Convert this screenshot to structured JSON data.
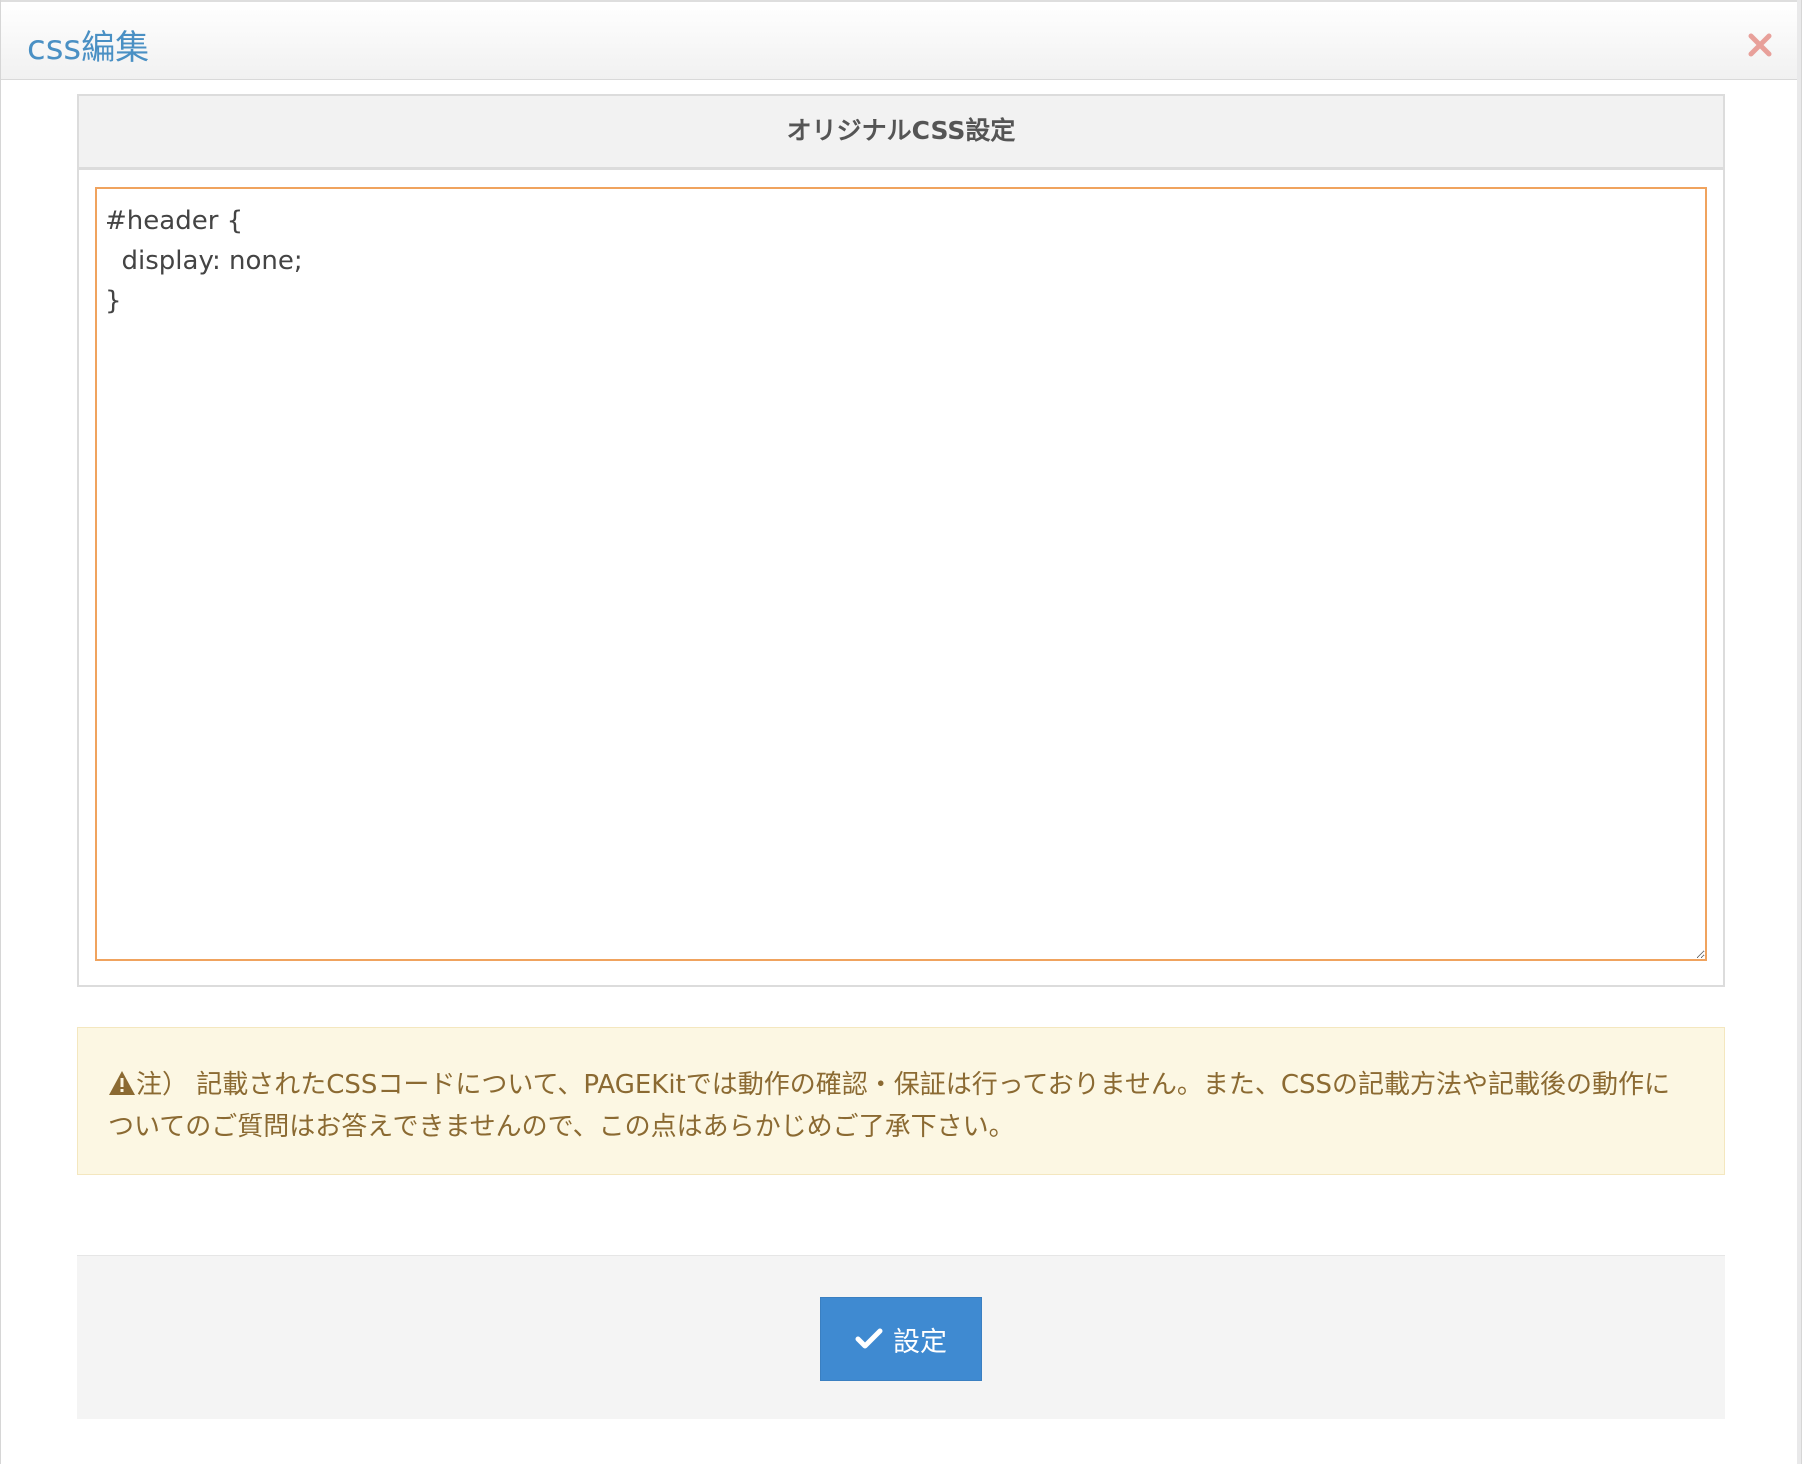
{
  "dialog": {
    "title": "css編集",
    "close_icon": "close-icon"
  },
  "panel": {
    "heading": "オリジナルCSS設定",
    "css_code": "#header {\n  display: none;\n}"
  },
  "notice": {
    "icon": "warning-icon",
    "text": "注） 記載されたCSSコードについて、PAGEKitでは動作の確認・保証は行っておりません。また、CSSの記載方法や記載後の動作についてのご質問はお答えできませんので、この点はあらかじめご了承下さい。"
  },
  "footer": {
    "submit_label": "設定",
    "submit_icon": "check-icon"
  },
  "colors": {
    "title": "#4a90c4",
    "close": "#e8a09a",
    "textarea_border": "#f0a35e",
    "notice_bg": "#fcf7e3",
    "notice_text": "#8b6a32",
    "button": "#3f8ad1"
  }
}
